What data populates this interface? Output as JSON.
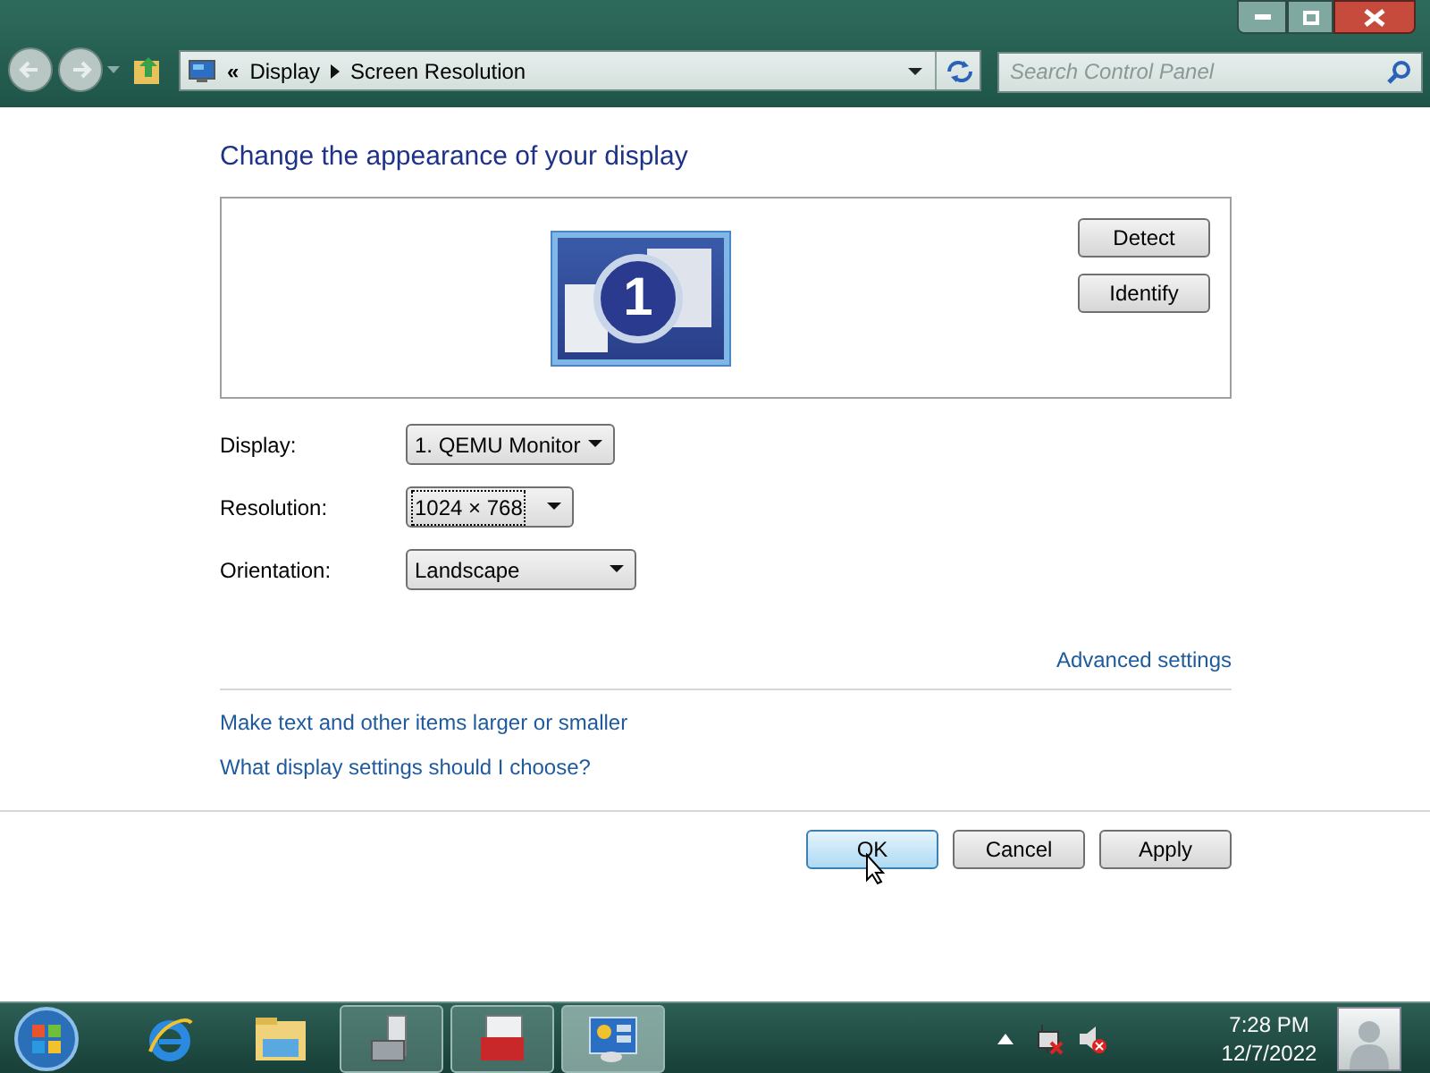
{
  "address_bar": {
    "overflow_chevron": "«",
    "crumbs": [
      "Display",
      "Screen Resolution"
    ]
  },
  "search": {
    "placeholder": "Search Control Panel"
  },
  "heading": "Change the appearance of your display",
  "monitor_panel": {
    "monitor_number": "1",
    "buttons": [
      "Detect",
      "Identify"
    ]
  },
  "settings": [
    {
      "label": "Display:",
      "value": "1. QEMU Monitor",
      "focused": false
    },
    {
      "label": "Resolution:",
      "value": "1024 × 768",
      "focused": true
    },
    {
      "label": "Orientation:",
      "value": "Landscape",
      "focused": false
    }
  ],
  "advanced_link": "Advanced settings",
  "links": [
    "Make text and other items larger or smaller",
    "What display settings should I choose?"
  ],
  "dialog_buttons": [
    {
      "label": "OK",
      "selected": true
    },
    {
      "label": "Cancel",
      "selected": false
    },
    {
      "label": "Apply",
      "selected": false
    }
  ],
  "taskbar": {
    "items": [
      {
        "kind": "browser",
        "running": false,
        "selected": false
      },
      {
        "kind": "folder",
        "running": false,
        "selected": false
      },
      {
        "kind": "tools",
        "running": true,
        "selected": false
      },
      {
        "kind": "toolbox",
        "running": true,
        "selected": false
      },
      {
        "kind": "display",
        "running": true,
        "selected": true
      }
    ],
    "time": "7:28 PM",
    "date": "12/7/2022"
  }
}
